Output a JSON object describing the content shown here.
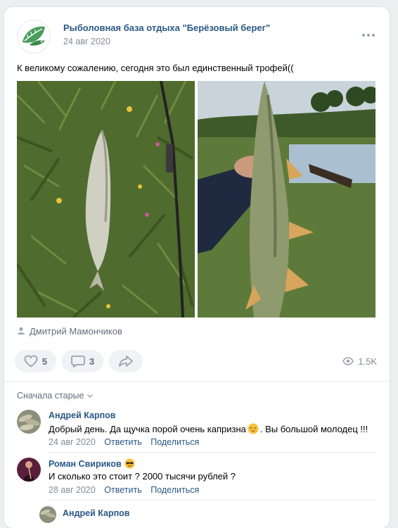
{
  "post": {
    "author": "Рыболовная база отдыха \"Берёзовый берег\"",
    "date": "24 авг 2020",
    "text": "К великому сожалению, сегодня это был единственный трофей((",
    "signature": "Дмитрий Мамончиков",
    "likes": "5",
    "comments": "3",
    "views": "1.5K"
  },
  "comments_section": {
    "sort_label": "Сначала старые",
    "items": [
      {
        "author": "Андрей Карпов",
        "text_before": "Добрый день. Да щучка порой очень капризна",
        "text_after": ". Вы большой молодец !!!",
        "date": "24 авг 2020",
        "reply": "Ответить",
        "share": "Поделиться"
      },
      {
        "author": "Роман Свириков",
        "text": "И сколько это стоит ? 2000 тысячи рублей ?",
        "date": "28 авг 2020",
        "reply": "Ответить",
        "share": "Поделиться"
      },
      {
        "author": "Андрей Карпов"
      }
    ]
  },
  "colors": {
    "link": "#2a5885",
    "muted": "#818c99",
    "button_bg": "#f0f2f5"
  }
}
